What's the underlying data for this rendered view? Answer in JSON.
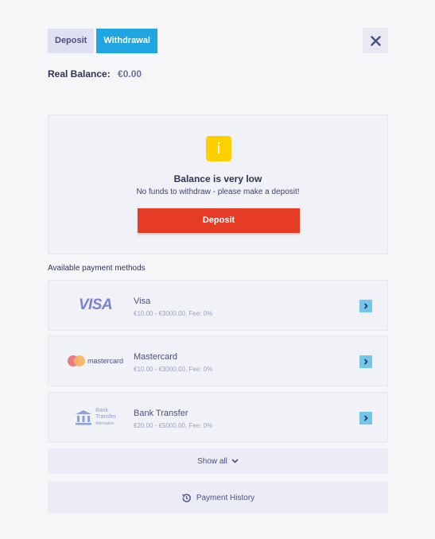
{
  "tabs": [
    {
      "label": "Deposit",
      "active": false
    },
    {
      "label": "Withdrawal",
      "active": true
    }
  ],
  "balance": {
    "label": "Real Balance:",
    "value": "€0.00"
  },
  "alert": {
    "title": "Balance is very low",
    "subtitle": "No funds to withdraw - please make a deposit!",
    "cta_label": "Deposit"
  },
  "payment_section_label": "Available payment methods",
  "methods": [
    {
      "logo_text": "VISA",
      "name": "Visa",
      "fee": "€10.00 - €3000.00, Fee: 0%"
    },
    {
      "logo_text": "mastercard",
      "name": "Mastercard",
      "fee": "€10.00 - €3000.00, Fee: 0%"
    },
    {
      "logo_text_1": "Bank",
      "logo_text_2": "Transfer",
      "logo_text_3": "Alternative",
      "name": "Bank Transfer",
      "fee": "€20.00 - €5000.00, Fee: 0%"
    }
  ],
  "show_all_label": "Show all",
  "history_label": "Payment History",
  "colors": {
    "accent": "#1fa6e0",
    "cta": "#e63b24",
    "warning": "#ffd000"
  }
}
